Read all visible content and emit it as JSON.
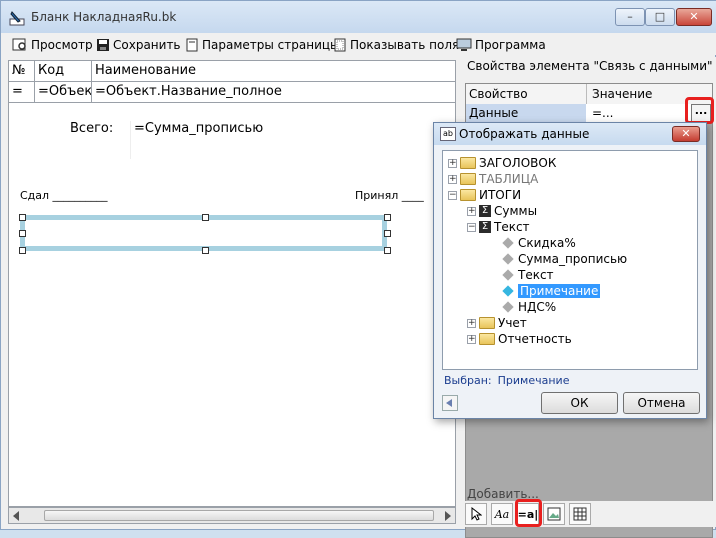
{
  "window": {
    "title": "Бланк  НакладнаяRu.bk",
    "min_glyph": "–",
    "max_glyph": "□",
    "close_glyph": "✕"
  },
  "toolbar": {
    "preview": "Просмотр",
    "save": "Сохранить",
    "page_setup": "Параметры страницы",
    "show_fields": "Показывать поля",
    "program": "Программа"
  },
  "document": {
    "table_headers": [
      "№",
      "Код",
      "Наименование"
    ],
    "table_row": [
      "=",
      "=Объек",
      "=Объект.Название_полное"
    ],
    "total_label": "Всего:",
    "total_value": "=Сумма_прописью",
    "handed_over": "Сдал __________",
    "received": "Принял ____"
  },
  "properties": {
    "title": "Свойства элемента \"Связь с данными\" :",
    "col_property": "Свойство",
    "col_value": "Значение",
    "row_name": "Данные",
    "row_value": "=...",
    "ellipsis": "...",
    "add_label": "Добавить..."
  },
  "bottom_tools": {
    "text_tool": "=a|",
    "font_tool": "Aa"
  },
  "dialog": {
    "title": "Отображать данные",
    "icon_text": "ab",
    "close_glyph": "✕",
    "tree": [
      {
        "label": "ЗАГОЛОВОК"
      },
      {
        "label": "ТАБЛИЦА"
      },
      {
        "label": "ИТОГИ"
      },
      {
        "label": "Суммы"
      },
      {
        "label": "Текст"
      },
      {
        "label": "Скидка%"
      },
      {
        "label": "Сумма_прописью"
      },
      {
        "label": "Текст"
      },
      {
        "label": "Примечание"
      },
      {
        "label": "НДС%"
      },
      {
        "label": "Учет"
      },
      {
        "label": "Отчетность"
      }
    ],
    "selected_label": "Выбран:",
    "selected_value": "Примечание",
    "ok": "ОК",
    "cancel": "Отмена"
  },
  "colors": {
    "selection": "#3399ff",
    "highlight_box": "#e8201f",
    "frame_selected": "#a7d1e0"
  }
}
